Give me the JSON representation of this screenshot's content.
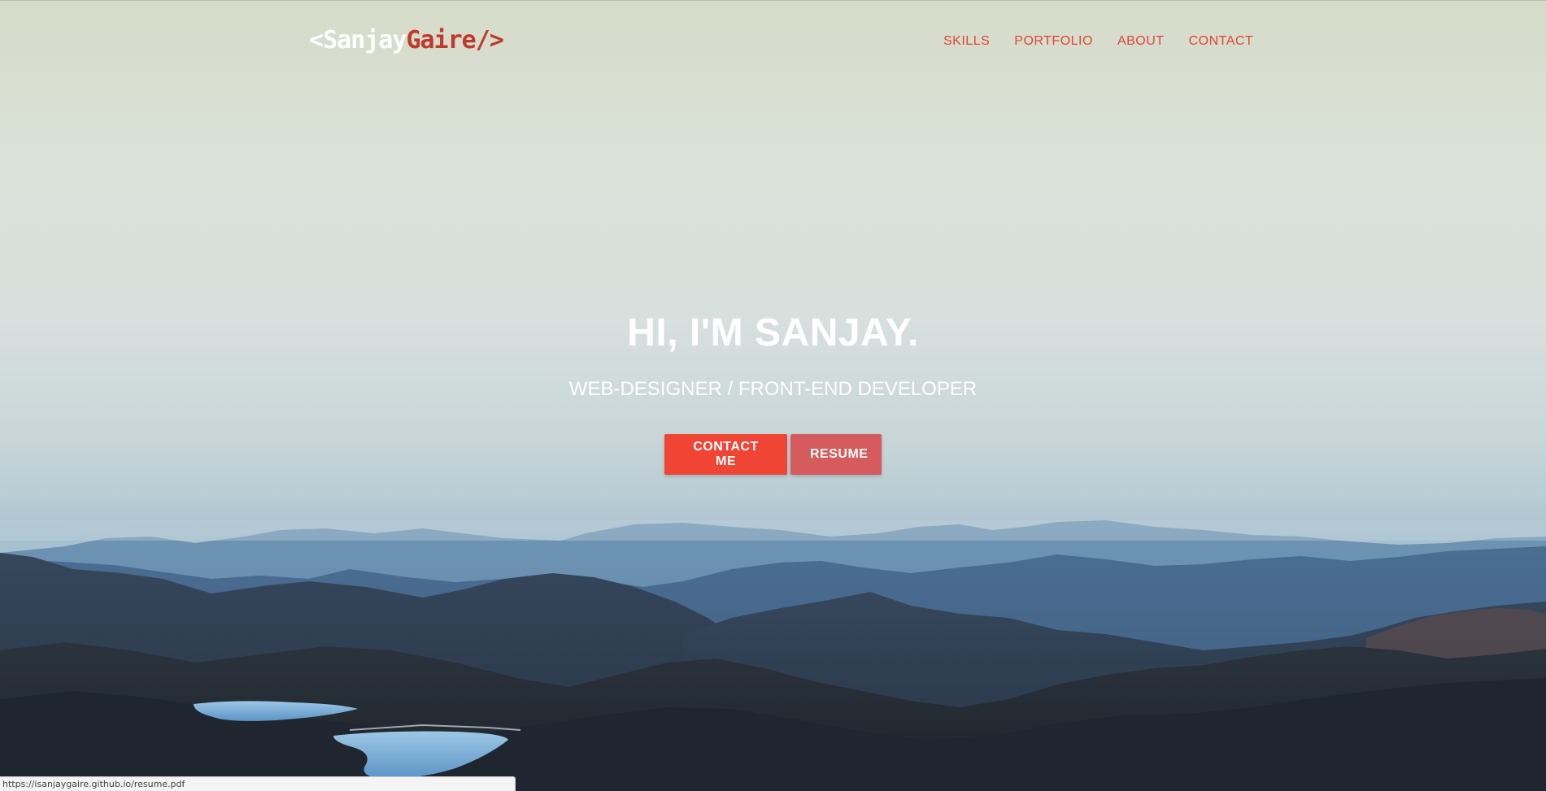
{
  "logo": {
    "open_bracket": "<",
    "first_name": "Sanjay",
    "last_name": "Gaire",
    "close_bracket": "/>"
  },
  "nav": {
    "items": [
      {
        "label": "SKILLS"
      },
      {
        "label": "PORTFOLIO"
      },
      {
        "label": "ABOUT"
      },
      {
        "label": "CONTACT"
      }
    ]
  },
  "hero": {
    "title": "HI, I'M SANJAY.",
    "subtitle": "WEB-DESIGNER / FRONT-END DEVELOPER",
    "buttons": {
      "contact_label": "CONTACT ME",
      "resume_label": "RESUME"
    }
  },
  "status_bar": {
    "url": "https://isanjaygaire.github.io/resume.pdf"
  },
  "colors": {
    "accent": "#f04435",
    "accent_muted": "#d65b5c",
    "logo_red": "#c0392b",
    "nav_link": "#e0463a"
  }
}
